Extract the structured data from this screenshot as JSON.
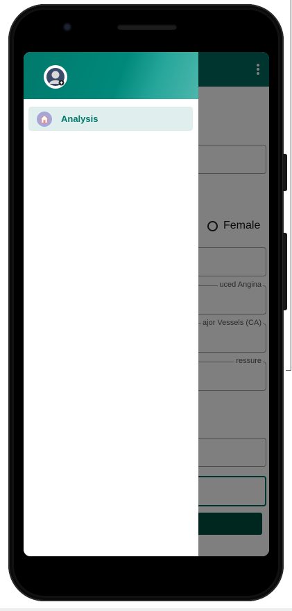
{
  "app": {
    "overflow_menu_icon": "more-vert-icon",
    "gender_option_female": "Female",
    "fields": {
      "angina_label_partial": "uced Angina",
      "vessels_label_partial": "ajor Vessels (CA)",
      "pressure_label_partial": "ressure"
    }
  },
  "drawer": {
    "header_avatar_icon": "account-circle-icon",
    "items": [
      {
        "label": "Analysis",
        "icon": "home-icon",
        "selected": true
      }
    ]
  },
  "colors": {
    "primary": "#00695c",
    "primary_dark": "#004d40",
    "drawer_item_selected_bg": "#e0efee",
    "drawer_item_text": "#00796b"
  }
}
